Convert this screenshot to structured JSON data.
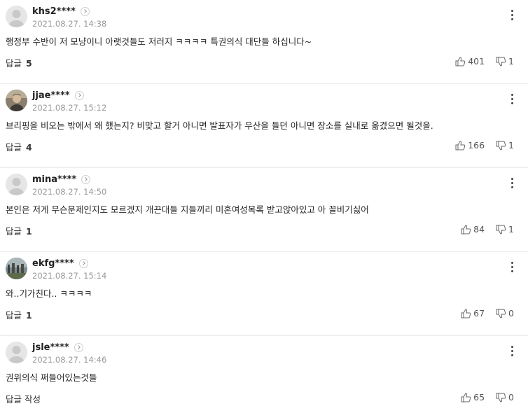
{
  "comments": [
    {
      "nickname": "khs2****",
      "date": "2021.08.27. 14:38",
      "text": "행정부 수반이 저 모냥이니 아랫것들도 저러지 ㅋㅋㅋㅋ 특권의식 대단들 하십니다~",
      "reply_label": "답글",
      "reply_count": "5",
      "likes": "401",
      "dislikes": "1",
      "avatar": "default"
    },
    {
      "nickname": "jjae****",
      "date": "2021.08.27. 15:12",
      "text": "브리핑을 비오는 밖에서 왜 했는지? 비맞고 할거 아니면 발표자가 우산을 들던 아니면 장소를 실내로 옮겼으면 될것을.",
      "reply_label": "답글",
      "reply_count": "4",
      "likes": "166",
      "dislikes": "1",
      "avatar": "photo-person"
    },
    {
      "nickname": "mina****",
      "date": "2021.08.27. 14:50",
      "text": "본인은 저게 무슨문제인지도 모르겠지 개끈대들 지들끼리 미혼여성목록 받고앉아있고 아 꼴비기싫어",
      "reply_label": "답글",
      "reply_count": "1",
      "likes": "84",
      "dislikes": "1",
      "avatar": "default"
    },
    {
      "nickname": "ekfg****",
      "date": "2021.08.27. 15:14",
      "text": "와..기가친다.. ㅋㅋㅋㅋ",
      "reply_label": "답글",
      "reply_count": "1",
      "likes": "67",
      "dislikes": "0",
      "avatar": "photo-landscape"
    },
    {
      "nickname": "jsle****",
      "date": "2021.08.27. 14:46",
      "text": "권위의식 쩌들어있는것들",
      "reply_label": "답글 작성",
      "reply_count": "",
      "likes": "65",
      "dislikes": "0",
      "avatar": "default"
    }
  ],
  "icons": {
    "like": "thumbs-up-icon",
    "dislike": "thumbs-down-icon",
    "more": "more-vertical-icon",
    "profile": "chevron-right-icon"
  }
}
